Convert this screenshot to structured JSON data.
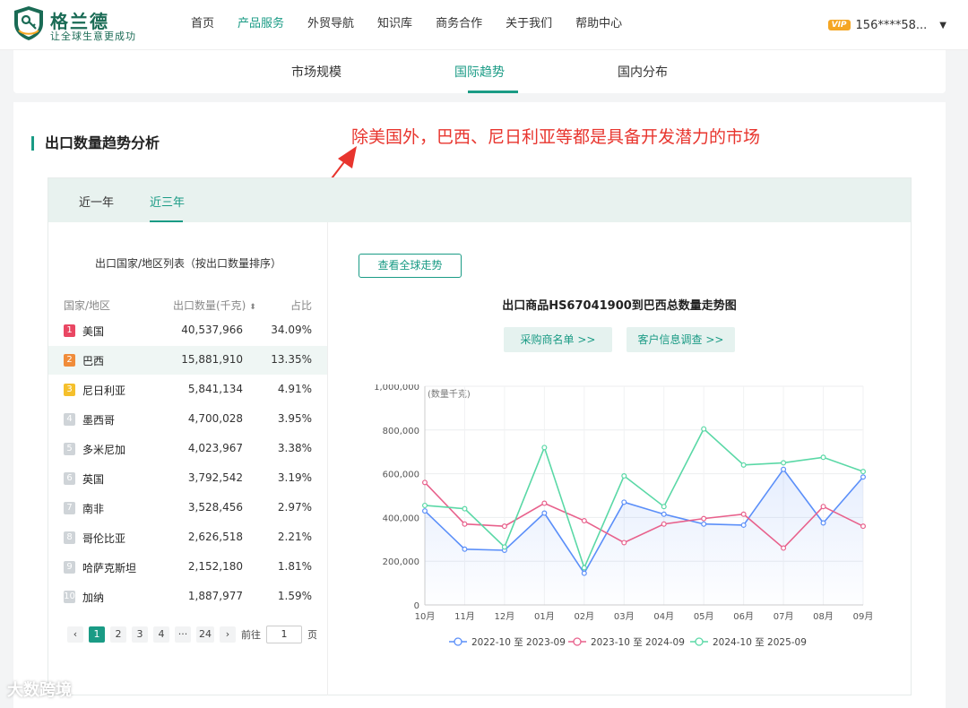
{
  "header": {
    "logo_title": "格兰德",
    "logo_subtitle": "让全球生意更成功",
    "nav": [
      "首页",
      "产品服务",
      "外贸导航",
      "知识库",
      "商务合作",
      "关于我们",
      "帮助中心"
    ],
    "nav_active": 1,
    "vip_label": "VIP",
    "user_phone": "156****58...",
    "brand_color": "#1a9b85"
  },
  "tabs": [
    "市场规模",
    "国际趋势",
    "国内分布"
  ],
  "tabs_active": 1,
  "section_title": "出口数量趋势分析",
  "annotation": "除美国外，巴西、尼日利亚等都是具备开发潜力的市场",
  "annotation_color": "#e8352e",
  "period_tabs": [
    "近一年",
    "近三年"
  ],
  "period_active": 1,
  "list": {
    "title": "出口国家/地区列表（按出口数量排序）",
    "headers": {
      "country": "国家/地区",
      "qty": "出口数量(千克)",
      "share": "占比"
    },
    "rows": [
      {
        "rank": "1",
        "country": "美国",
        "qty": "40,537,966",
        "share": "34.09%"
      },
      {
        "rank": "2",
        "country": "巴西",
        "qty": "15,881,910",
        "share": "13.35%"
      },
      {
        "rank": "3",
        "country": "尼日利亚",
        "qty": "5,841,134",
        "share": "4.91%"
      },
      {
        "rank": "4",
        "country": "墨西哥",
        "qty": "4,700,028",
        "share": "3.95%"
      },
      {
        "rank": "5",
        "country": "多米尼加",
        "qty": "4,023,967",
        "share": "3.38%"
      },
      {
        "rank": "6",
        "country": "英国",
        "qty": "3,792,542",
        "share": "3.19%"
      },
      {
        "rank": "7",
        "country": "南非",
        "qty": "3,528,456",
        "share": "2.97%"
      },
      {
        "rank": "8",
        "country": "哥伦比亚",
        "qty": "2,626,518",
        "share": "2.21%"
      },
      {
        "rank": "9",
        "country": "哈萨克斯坦",
        "qty": "2,152,180",
        "share": "1.81%"
      },
      {
        "rank": "10",
        "country": "加纳",
        "qty": "1,887,977",
        "share": "1.59%"
      }
    ],
    "highlight_row": 1
  },
  "pager": {
    "prev": "‹",
    "next": "›",
    "pages": [
      "1",
      "2",
      "3",
      "4",
      "···",
      "24"
    ],
    "current": "1",
    "goto_label": "前往",
    "goto_value": "1",
    "goto_suffix": "页"
  },
  "global_trend_button": "查看全球走势",
  "chart_title": "出口商品HS67041900到巴西总数量走势图",
  "action_buttons": [
    "采购商名单 >>",
    "客户信息调查 >>"
  ],
  "chart_data": {
    "type": "line",
    "ylabel": "(数量千克)",
    "ylim": [
      0,
      1000000
    ],
    "yticks": [
      0,
      200000,
      400000,
      600000,
      800000,
      1000000
    ],
    "ytick_labels": [
      "0",
      "200,000",
      "400,000",
      "600,000",
      "800,000",
      "1,000,000"
    ],
    "categories": [
      "10月",
      "11月",
      "12月",
      "01月",
      "02月",
      "03月",
      "04月",
      "05月",
      "06月",
      "07月",
      "08月",
      "09月"
    ],
    "series": [
      {
        "name": "2022-10 至 2023-09",
        "color": "#5b8ff9",
        "values": [
          430000,
          255000,
          250000,
          420000,
          145000,
          470000,
          415000,
          370000,
          365000,
          620000,
          375000,
          585000
        ]
      },
      {
        "name": "2023-10 至 2024-09",
        "color": "#e8618c",
        "values": [
          560000,
          370000,
          360000,
          465000,
          385000,
          285000,
          370000,
          395000,
          415000,
          260000,
          450000,
          360000
        ]
      },
      {
        "name": "2024-10 至 2025-09",
        "color": "#5ad8a6",
        "values": [
          455000,
          440000,
          265000,
          720000,
          170000,
          590000,
          450000,
          805000,
          640000,
          650000,
          675000,
          610000
        ]
      }
    ],
    "grid": true,
    "legend": "bottom"
  },
  "footer_watermark": "大数跨境"
}
